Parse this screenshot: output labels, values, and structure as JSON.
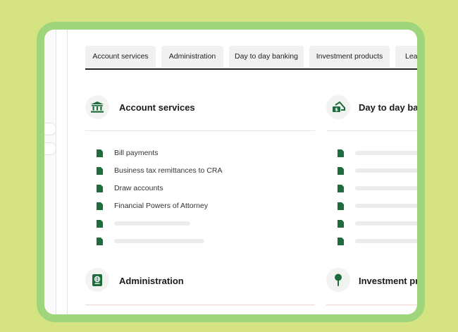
{
  "tabs": [
    {
      "label": "Account services"
    },
    {
      "label": "Administration"
    },
    {
      "label": "Day to day banking"
    },
    {
      "label": "Investment products"
    },
    {
      "label": "Lea"
    }
  ],
  "sections": {
    "account_services": {
      "title": "Account services",
      "icon": "bank-icon",
      "items": [
        "Bill payments",
        "Business tax remittances to CRA",
        "Draw accounts",
        "Financial Powers of Attorney"
      ]
    },
    "day_to_day": {
      "title": "Day to day banl",
      "icon": "cash-hand-icon"
    },
    "administration": {
      "title": "Administration",
      "icon": "passport-icon"
    },
    "investment": {
      "title": "Investment pro",
      "icon": "pin-icon"
    }
  },
  "colors": {
    "background": "#d5e382",
    "frame": "#9fd57b",
    "accent": "#1e6b3c"
  }
}
